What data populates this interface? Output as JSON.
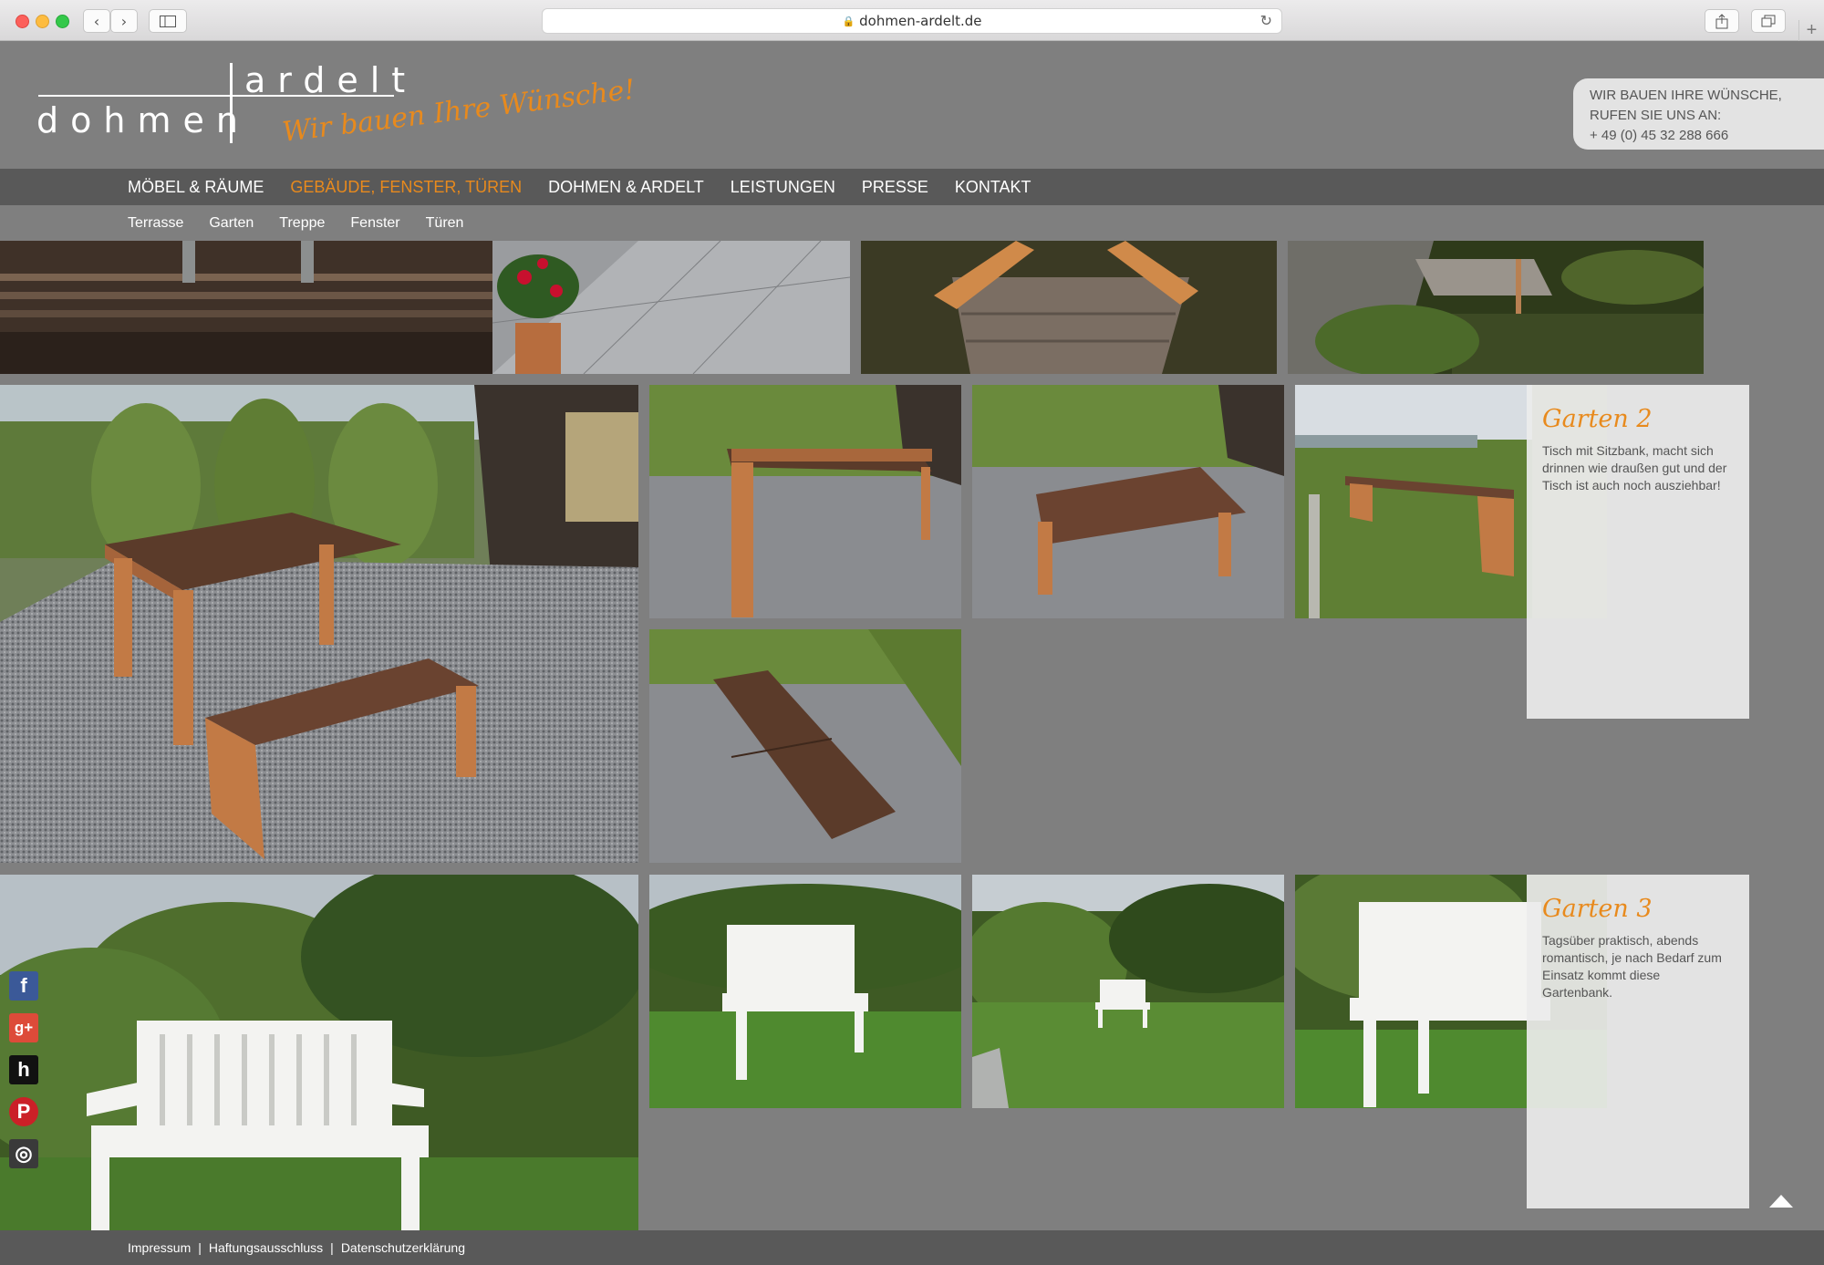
{
  "browser": {
    "url": "dohmen-ardelt.de",
    "lock_icon": "lock-icon",
    "back_icon": "chevron-left-icon",
    "forward_icon": "chevron-right-icon"
  },
  "logo": {
    "top_word": "ardelt",
    "bottom_word": "dohmen",
    "slogan": "Wir bauen Ihre Wünsche!"
  },
  "contact": {
    "line1": "WIR BAUEN IHRE WÜNSCHE,",
    "line2": "RUFEN SIE UNS AN:",
    "phone": "+ 49 (0) 45 32 288 666"
  },
  "main_nav": [
    {
      "label": "MÖBEL & RÄUME",
      "active": false
    },
    {
      "label": "GEBÄUDE, FENSTER, TÜREN",
      "active": true
    },
    {
      "label": "DOHMEN & ARDELT",
      "active": false
    },
    {
      "label": "LEISTUNGEN",
      "active": false
    },
    {
      "label": "PRESSE",
      "active": false
    },
    {
      "label": "KONTAKT",
      "active": false
    }
  ],
  "sub_nav": [
    "Terrasse",
    "Garten",
    "Treppe",
    "Fenster",
    "Türen"
  ],
  "galleries": [
    {
      "title": "Garten 2",
      "text": "Tisch mit Sitzbank, macht sich drinnen wie draußen gut und der Tisch ist auch noch ausziehbar!"
    },
    {
      "title": "Garten 3",
      "text": "Tagsüber praktisch, abends romantisch, je nach Bedarf zum Einsatz kommt diese Gartenbank."
    }
  ],
  "social": [
    "facebook-icon",
    "google-plus-icon",
    "houzz-icon",
    "pinterest-icon",
    "instagram-icon"
  ],
  "social_glyphs": {
    "facebook": "f",
    "google": "g+",
    "houzz": "h",
    "pinterest": "P",
    "instagram": "◎"
  },
  "footer": [
    "Impressum",
    "Haftungsausschluss",
    "Datenschutzerklärung"
  ],
  "colors": {
    "accent": "#e88a1d",
    "background": "#7f7f7f",
    "nav_bar": "#595959",
    "info_box": "#ececec"
  }
}
